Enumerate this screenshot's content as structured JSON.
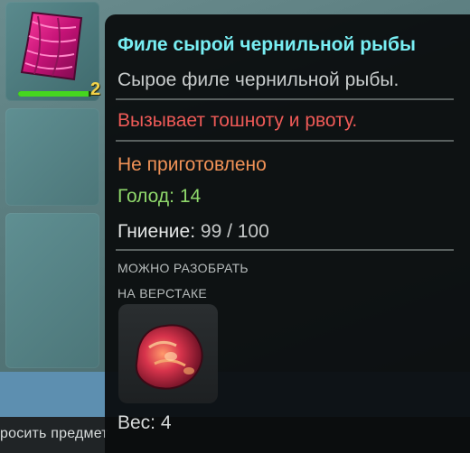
{
  "inventory": {
    "slot_1": {
      "icon": "raw-fish-fillet-icon",
      "stack_count": "2",
      "durability": 0.95
    },
    "slot_2": {
      "icon": ""
    },
    "slot_3": {
      "icon": ""
    }
  },
  "tooltip": {
    "title": "Филе сырой чернильной рыбы",
    "description": "Сырое филе чернильной рыбы.",
    "warning": "Вызывает тошноту и рвоту.",
    "cook_state": "Не приготовлено",
    "hunger_label": "Голод:",
    "hunger_value": "14",
    "decay_label": "Гниение:",
    "decay_value": "99 / 100",
    "craft_line_1": "МОЖНО РАЗОБРАТЬ",
    "craft_line_2": "НА ВЕРСТАКЕ",
    "craft_result_icon": "raw-meat-chunk-icon",
    "weight_label": "Вес:",
    "weight_value": "4"
  },
  "footer": {
    "drop_label": "росить предмет"
  },
  "colors": {
    "title": "#78eef3",
    "warning": "#ee5a57",
    "cook_state": "#f19257",
    "hunger": "#8fd86b",
    "stack_count": "#f2d34a",
    "durability": "#45d61f"
  }
}
